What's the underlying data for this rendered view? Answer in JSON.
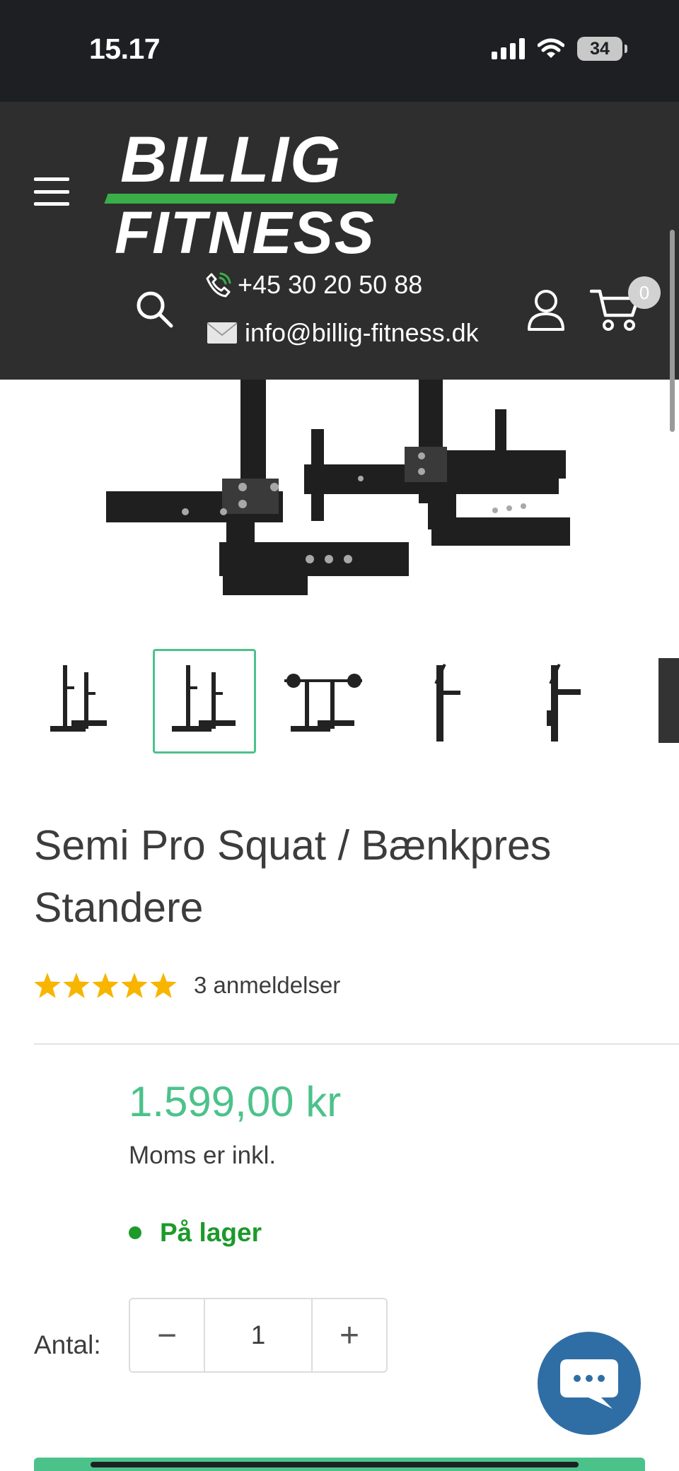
{
  "status_bar": {
    "time": "15.17",
    "battery": "34"
  },
  "header": {
    "menu_icon": "hamburger-icon",
    "logo": {
      "line1": "BILLIG",
      "line2": "FITNESS"
    },
    "phone": "+45 30 20 50 88",
    "email": "info@billig-fitness.dk",
    "cart_count": "0",
    "colors": {
      "background": "#2e2e2e",
      "brand_green": "#3aae49"
    }
  },
  "gallery": {
    "thumbnail_count": 6,
    "active_thumbnail": 2
  },
  "product": {
    "title": "Semi Pro Squat / Bænkpres Standere",
    "rating": 5,
    "reviews": "3 anmeldelser",
    "price": "1.599,00 kr",
    "tax_note": "Moms er inkl.",
    "stock": "På lager",
    "colors": {
      "price": "#4cc28b",
      "stock": "#1c9a2a",
      "star": "#f7b500"
    }
  },
  "quantity": {
    "label": "Antal:",
    "decrease": "−",
    "value": "1",
    "increase": "+"
  },
  "chat": {
    "icon": "chat-bubble-icon"
  }
}
